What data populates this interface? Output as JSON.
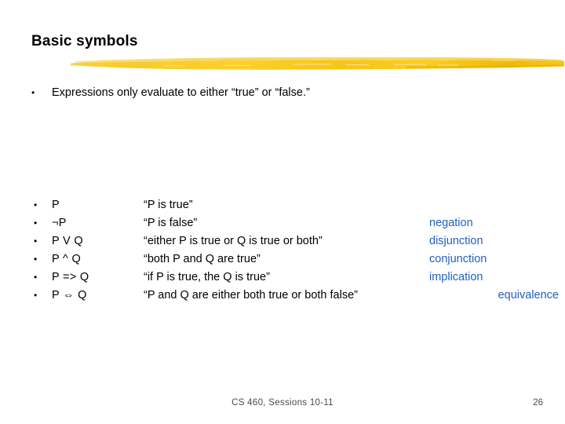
{
  "slide": {
    "title": "Basic symbols",
    "intro_bullet": "Expressions only evaluate to either “true” or “false.”",
    "bullet_glyph": "•",
    "accent_color": "#F2C21A",
    "label_color": "#1F60BF",
    "rows": [
      {
        "expr": "P",
        "desc": "“P is true”",
        "name": ""
      },
      {
        "expr": "¬P",
        "desc": "“P is false”",
        "name": "negation"
      },
      {
        "expr": "P V Q",
        "desc": "“either P is true or Q is true or both”",
        "name": "disjunction"
      },
      {
        "expr": "P ^ Q",
        "desc": "“both P and Q are true”",
        "name": "conjunction"
      },
      {
        "expr": "P => Q",
        "desc": "“if P is true, the Q is true”",
        "name": "implication"
      },
      {
        "expr": "P ⇔ Q",
        "desc": "“P and Q are either both true or both false”",
        "name": "equivalence"
      }
    ],
    "footer": {
      "note": "CS 460,  Sessions 10-11",
      "page": "26"
    }
  }
}
